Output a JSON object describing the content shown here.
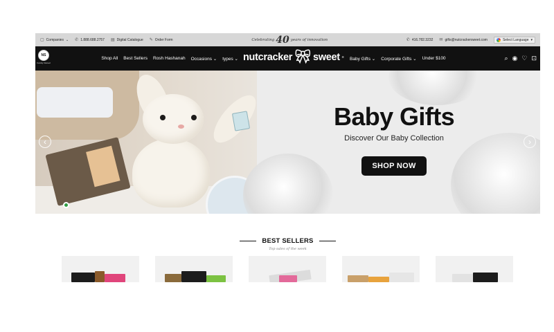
{
  "topbar": {
    "companies": "Companies",
    "phone": "1.888.688.2757",
    "catalogue": "Digital Catalogue",
    "order_form": "Order Form",
    "celebrating": "Celebrating",
    "years": "40",
    "innovation": "years of innovation",
    "phone_right": "416.782.3232",
    "email": "gifts@nutcrackersweet.com",
    "language": "Select Language"
  },
  "nav": {
    "badge": "NS",
    "badge_caption": "Family Owned",
    "left_items": [
      "Shop All",
      "Best Sellers",
      "Rosh Hashanah",
      "Occasions ⌄",
      "types ⌄"
    ],
    "logo_left": "nutcracker",
    "logo_right": "sweet",
    "reg_mark": "®",
    "right_items": [
      "Baby Gifts ⌄",
      "Corporate Gifts ⌄",
      "Under $100"
    ],
    "cart_count": "0"
  },
  "hero": {
    "title": "Baby Gifts",
    "subtitle": "Discover Our Baby Collection",
    "button": "SHOP NOW"
  },
  "bestsellers": {
    "title": "BEST SELLERS",
    "subtitle": "Top sales of the week"
  },
  "colors": {
    "nav_bg": "#111111",
    "topbar_bg": "#d7d7d7",
    "hero_bg": "#ececec",
    "button_bg": "#111111"
  }
}
